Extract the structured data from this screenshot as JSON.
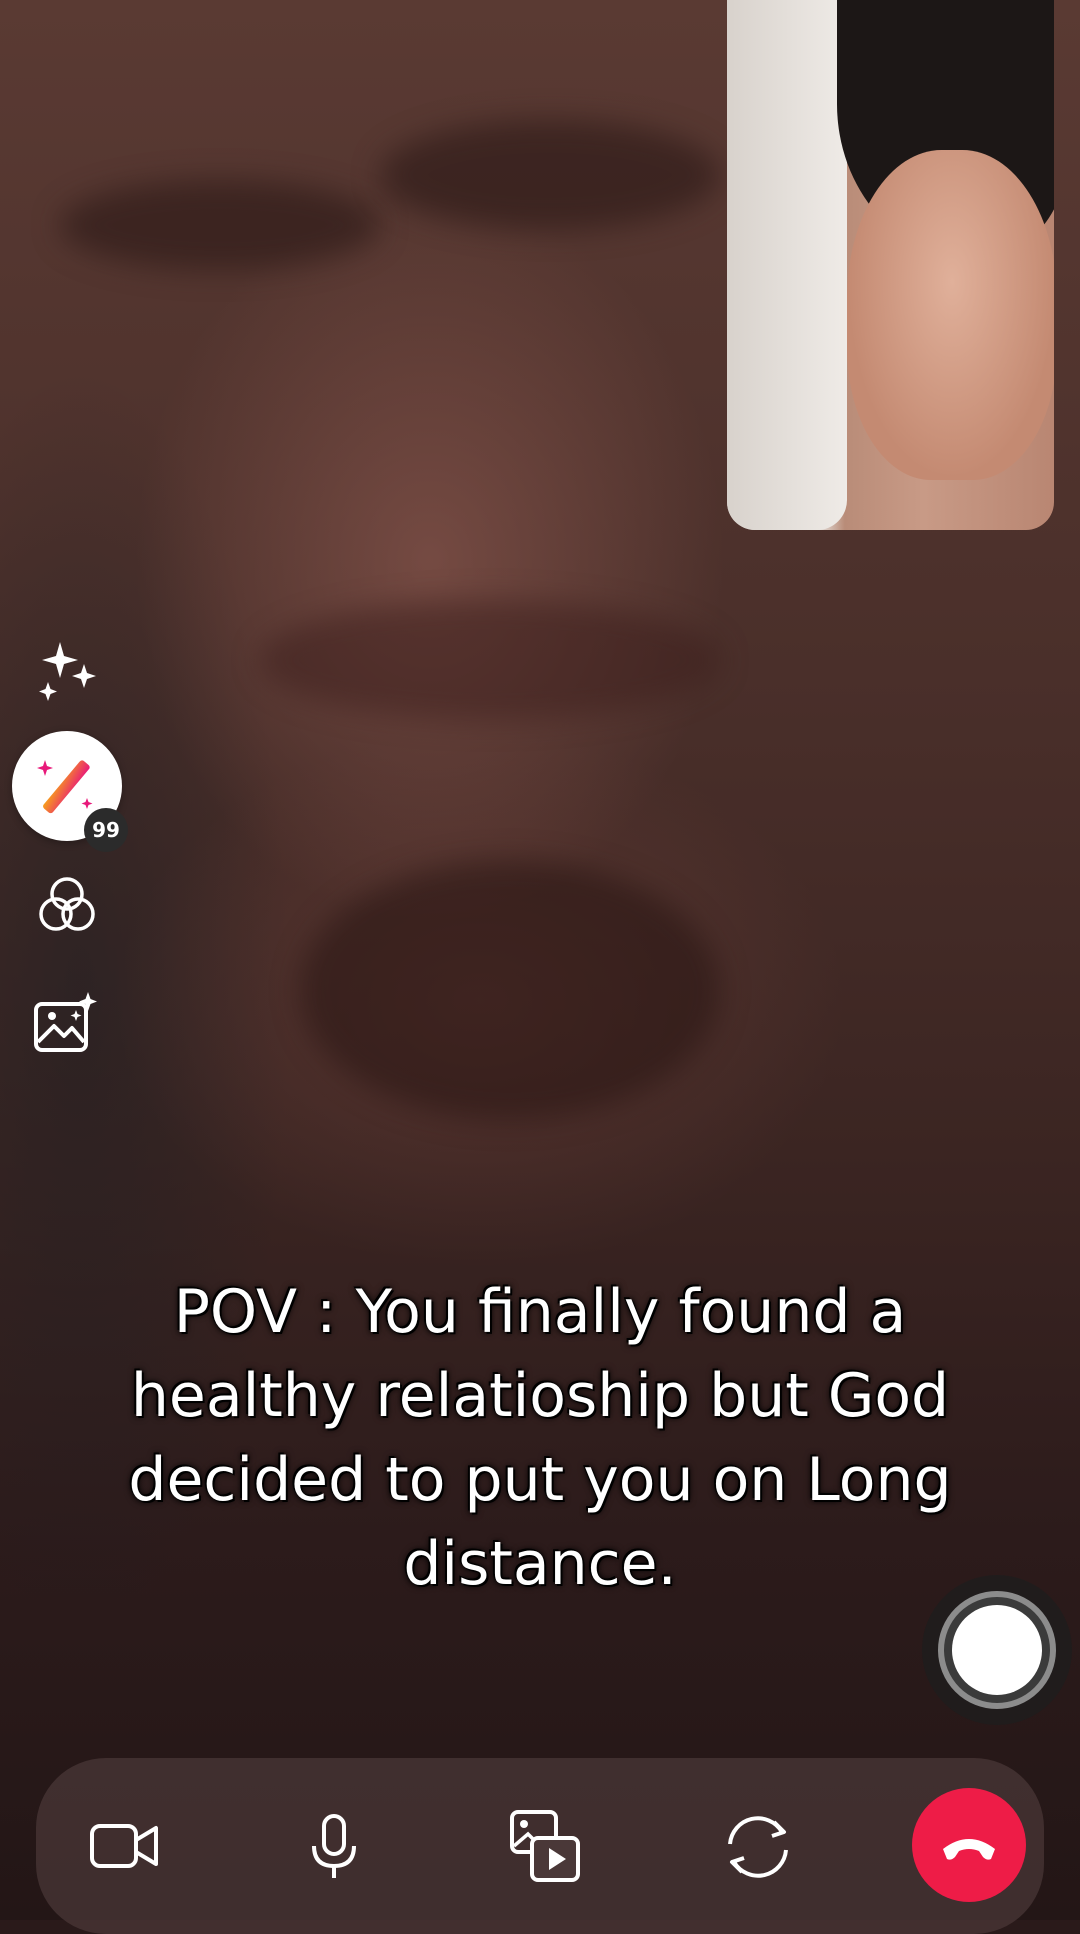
{
  "call": {
    "caption": "POV : You finally found a healthy relatioship but God decided to put you on Long distance."
  },
  "effects": {
    "badge_count": "99"
  },
  "icons": {
    "sparkles": "sparkles-icon",
    "effects_wand": "magic-wand-icon",
    "filters": "filters-icon",
    "background": "image-sparkle-icon",
    "camera": "video-camera-icon",
    "mic": "microphone-icon",
    "share": "media-share-icon",
    "flip": "flip-camera-icon",
    "end_call": "end-call-icon"
  },
  "colors": {
    "end_call": "#ee1c47",
    "control_bar": "rgba(80,62,62,0.62)"
  }
}
